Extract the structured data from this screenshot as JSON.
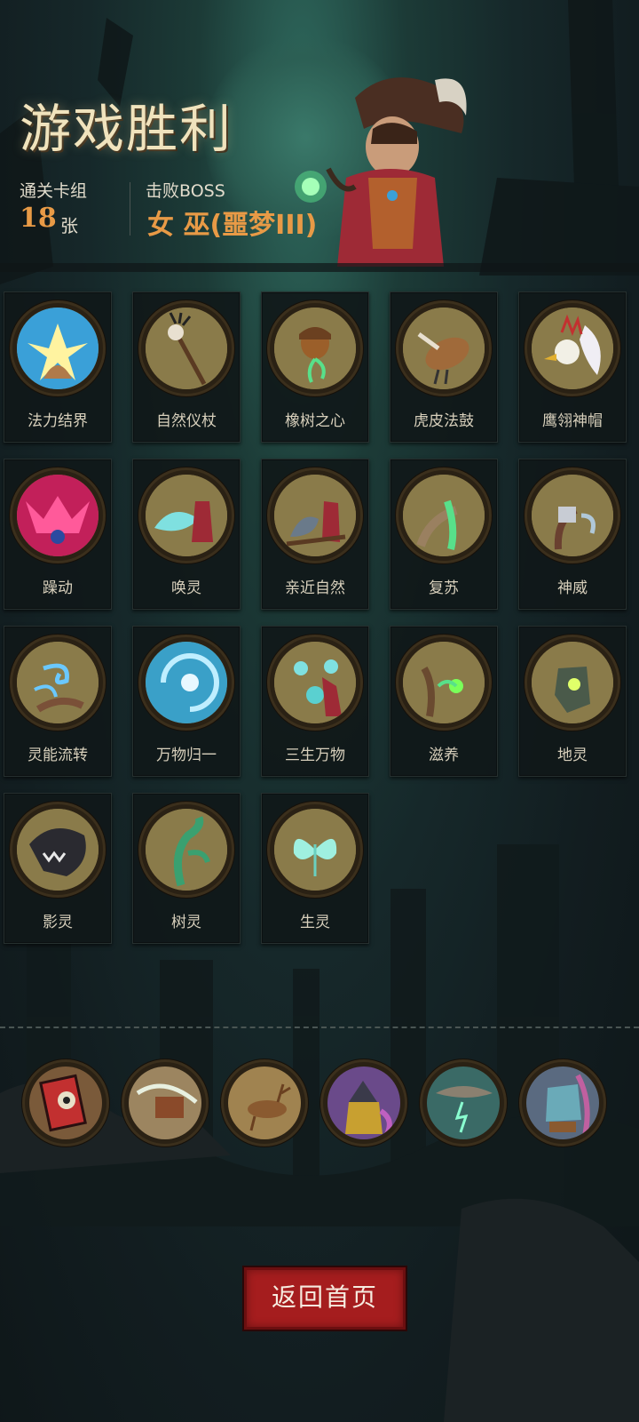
{
  "header": {
    "title": "游戏胜利",
    "deck_label": "通关卡组",
    "deck_count": "18",
    "deck_unit": "张",
    "boss_label": "击败BOSS",
    "boss_name": "女 巫(噩梦III)"
  },
  "cards": [
    {
      "name": "法力结界",
      "icon": "mana-barrier-icon",
      "color": "#3aa0d8"
    },
    {
      "name": "自然仪杖",
      "icon": "nature-staff-icon",
      "color": "#8a7b4a"
    },
    {
      "name": "橡树之心",
      "icon": "acorn-heart-icon",
      "color": "#8a7b4a"
    },
    {
      "name": "虎皮法鼓",
      "icon": "tiger-drum-icon",
      "color": "#8a7b4a"
    },
    {
      "name": "鹰翎神帽",
      "icon": "feather-headdress-icon",
      "color": "#8a7b4a"
    },
    {
      "name": "躁动",
      "icon": "frenzy-icon",
      "color": "#c2205a"
    },
    {
      "name": "唤灵",
      "icon": "summon-spirit-icon",
      "color": "#8a7b4a"
    },
    {
      "name": "亲近自然",
      "icon": "nature-affinity-icon",
      "color": "#8a7b4a"
    },
    {
      "name": "复苏",
      "icon": "revival-icon",
      "color": "#8a7b4a"
    },
    {
      "name": "神威",
      "icon": "divine-might-icon",
      "color": "#8a7b4a"
    },
    {
      "name": "灵能流转",
      "icon": "spirit-flow-icon",
      "color": "#8a7b4a"
    },
    {
      "name": "万物归一",
      "icon": "vortex-icon",
      "color": "#3aa0c8"
    },
    {
      "name": "三生万物",
      "icon": "spirits-icon",
      "color": "#8a7b4a"
    },
    {
      "name": "滋养",
      "icon": "nourish-icon",
      "color": "#8a7b4a"
    },
    {
      "name": "地灵",
      "icon": "earth-spirit-icon",
      "color": "#8a7b4a"
    },
    {
      "name": "影灵",
      "icon": "shadow-spirit-icon",
      "color": "#8a7b4a"
    },
    {
      "name": "树灵",
      "icon": "tree-spirit-icon",
      "color": "#8a7b4a"
    },
    {
      "name": "生灵",
      "icon": "butterfly-spirit-icon",
      "color": "#8a7b4a"
    }
  ],
  "relics": [
    {
      "icon": "skull-card-relic-icon",
      "color": "#7a5a3a"
    },
    {
      "icon": "book-wind-relic-icon",
      "color": "#9c8560"
    },
    {
      "icon": "deer-relic-icon",
      "color": "#a08350"
    },
    {
      "icon": "wizard-relic-icon",
      "color": "#6a4a8a"
    },
    {
      "icon": "storm-relic-icon",
      "color": "#3a6a66"
    },
    {
      "icon": "golem-relic-icon",
      "color": "#5a6a80"
    }
  ],
  "actions": {
    "back_home": "返回首页"
  }
}
